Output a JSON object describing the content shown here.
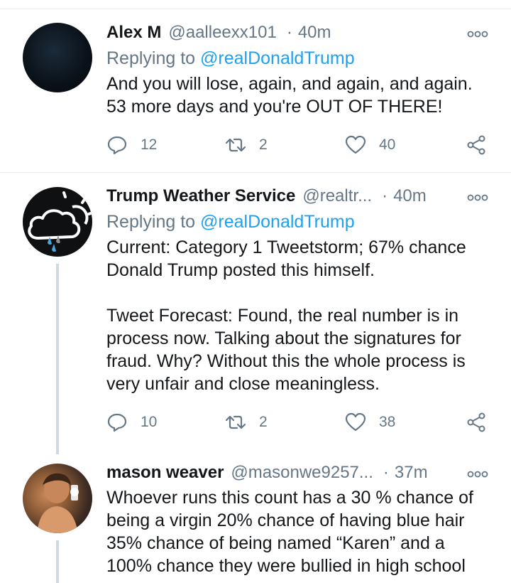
{
  "tweets": [
    {
      "name": "Alex M",
      "handle": "@aalleexx101",
      "time": "40m",
      "replying_prefix": "Replying to ",
      "replying_to": "@realDonaldTrump",
      "text": "And you will lose, again, and again, and again.\n53 more days and you're OUT OF THERE!",
      "replies": "12",
      "retweets": "2",
      "likes": "40"
    },
    {
      "name": "Trump Weather Service",
      "handle": "@realtr...",
      "time": "40m",
      "replying_prefix": "Replying to ",
      "replying_to": "@realDonaldTrump",
      "text": "Current: Category 1 Tweetstorm; 67% chance\nDonald Trump posted this himself.\n\nTweet Forecast: Found, the real number is in\nprocess now. Talking about the signatures for\nfraud. Why? Without this the whole process is\nvery unfair and close meaningless.",
      "replies": "10",
      "retweets": "2",
      "likes": "38"
    },
    {
      "name": "mason weaver",
      "handle": "@masonwe9257...",
      "time": "37m",
      "text": "Whoever runs this count has a 30 % chance of\nbeing a virgin 20% chance of having blue hair\n35% chance of being named “Karen” and a\n100% chance they were bullied in high school"
    }
  ],
  "icons": {
    "reply": "reply-icon",
    "retweet": "retweet-icon",
    "like": "heart-icon",
    "share": "share-icon",
    "more": "more-icon"
  },
  "colors": {
    "link": "#1da1f2",
    "secondary": "#657786",
    "text": "#14171a",
    "divider": "#e6ecf0",
    "thread_line": "#cfd9de"
  }
}
